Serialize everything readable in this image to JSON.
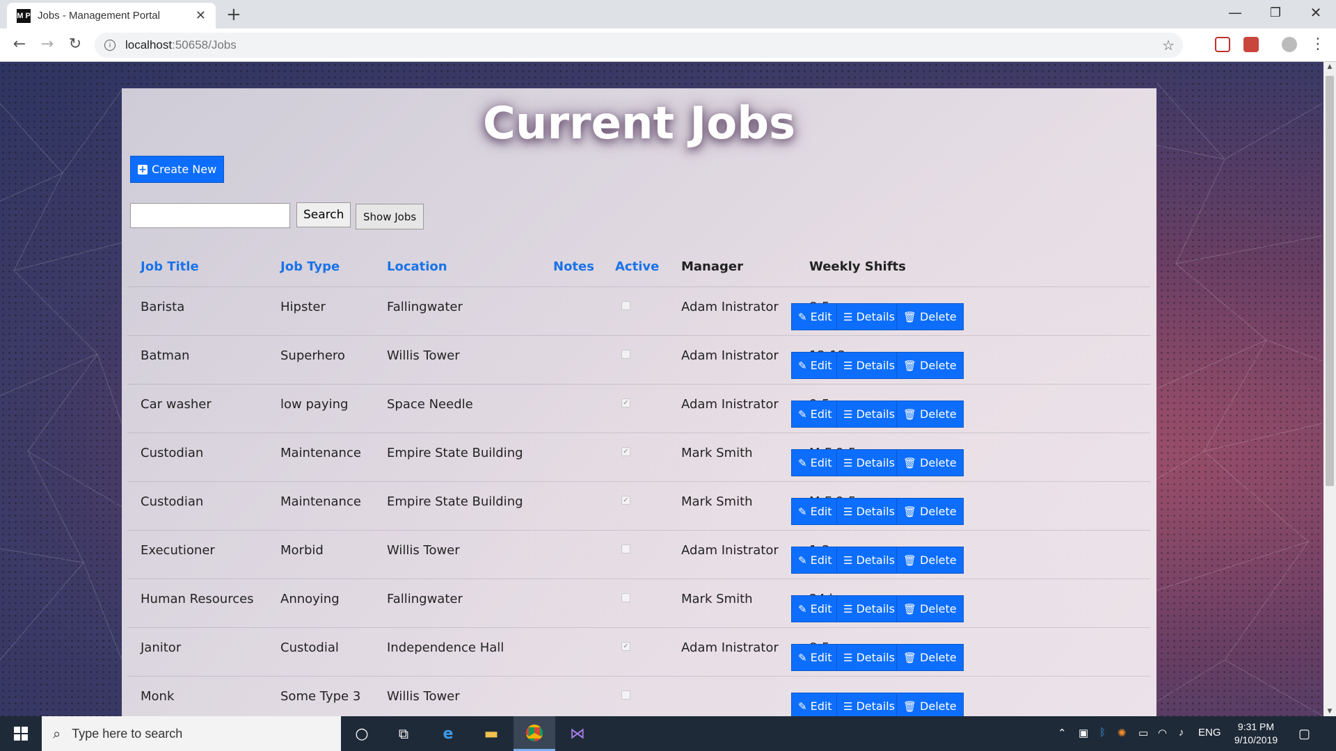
{
  "browser": {
    "tab_title": "Jobs - Management Portal",
    "favicon_text": "M P",
    "url_host": "localhost",
    "url_rest": ":50658/Jobs"
  },
  "page": {
    "title": "Current Jobs",
    "create_label": "Create New",
    "search_value": "",
    "search_label": "Search",
    "show_jobs_label": "Show Jobs"
  },
  "table": {
    "headers": [
      "Job Title",
      "Job Type",
      "Location",
      "Notes",
      "Active",
      "Manager",
      "Weekly Shifts"
    ],
    "rows": [
      {
        "title": "Barista",
        "type": "Hipster",
        "location": "Fallingwater",
        "notes": "",
        "active": false,
        "manager": "Adam Inistrator",
        "shifts": "8-5"
      },
      {
        "title": "Batman",
        "type": "Superhero",
        "location": "Willis Tower",
        "notes": "",
        "active": false,
        "manager": "Adam Inistrator",
        "shifts": "12-12"
      },
      {
        "title": "Car washer",
        "type": "low paying",
        "location": "Space Needle",
        "notes": "",
        "active": true,
        "manager": "Adam Inistrator",
        "shifts": "9-5"
      },
      {
        "title": "Custodian",
        "type": "Maintenance",
        "location": "Empire State Building",
        "notes": "",
        "active": true,
        "manager": "Mark Smith",
        "shifts": "M-F 9-5"
      },
      {
        "title": "Custodian",
        "type": "Maintenance",
        "location": "Empire State Building",
        "notes": "",
        "active": true,
        "manager": "Mark Smith",
        "shifts": "M-F 9-5"
      },
      {
        "title": "Executioner",
        "type": "Morbid",
        "location": "Willis Tower",
        "notes": "",
        "active": false,
        "manager": "Adam Inistrator",
        "shifts": "1-3"
      },
      {
        "title": "Human Resources",
        "type": "Annoying",
        "location": "Fallingwater",
        "notes": "",
        "active": false,
        "manager": "Mark Smith",
        "shifts": "24 hours"
      },
      {
        "title": "Janitor",
        "type": "Custodial",
        "location": "Independence Hall",
        "notes": "",
        "active": true,
        "manager": "Adam Inistrator",
        "shifts": "8-5"
      },
      {
        "title": "Monk",
        "type": "Some Type 3",
        "location": "Willis Tower",
        "notes": "",
        "active": false,
        "manager": "",
        "shifts": ""
      }
    ],
    "actions": {
      "edit": "Edit",
      "details": "Details",
      "delete": "Delete"
    }
  },
  "taskbar": {
    "search_placeholder": "Type here to search",
    "language": "ENG",
    "time": "9:31 PM",
    "date": "9/10/2019"
  },
  "colors": {
    "accent": "#0d6efd",
    "link": "#1a73e8"
  }
}
